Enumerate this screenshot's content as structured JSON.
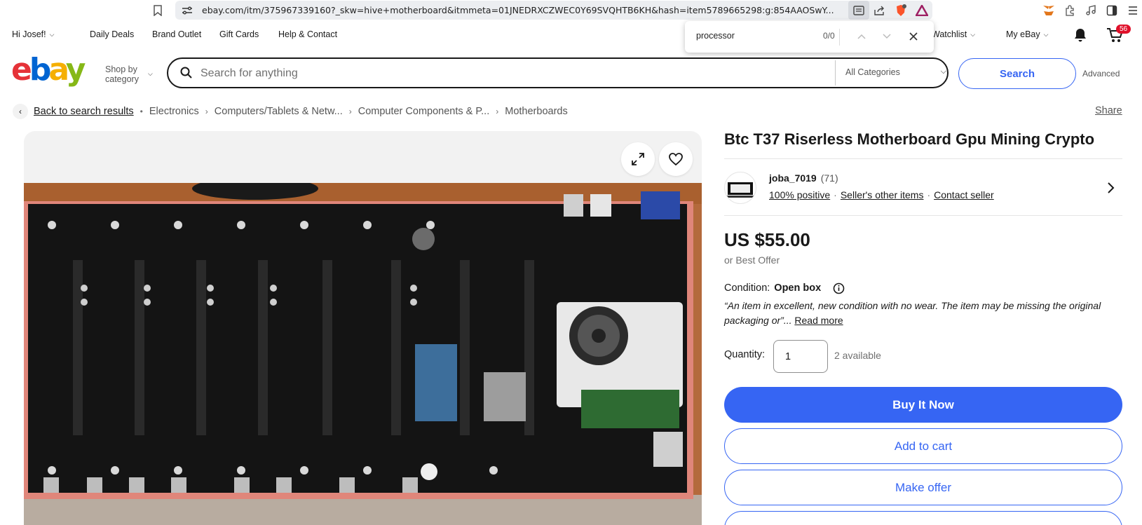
{
  "browser": {
    "url": "ebay.com/itm/375967339160?_skw=hive+motherboard&itmmeta=01JNEDRXCZWEC0Y69SVQHTB6KH&hash=item5789665298:g:854AAOSwY..."
  },
  "find_bar": {
    "query": "processor",
    "count": "0/0"
  },
  "top_nav": {
    "greeting": "Hi Josef!",
    "daily_deals": "Daily Deals",
    "brand_outlet": "Brand Outlet",
    "gift_cards": "Gift Cards",
    "help_contact": "Help & Contact",
    "watchlist": "Watchlist",
    "my_ebay": "My eBay",
    "cart_count": "56"
  },
  "header": {
    "shop_by_line1": "Shop by",
    "shop_by_line2": "category",
    "search_placeholder": "Search for anything",
    "category": "All Categories",
    "search_button": "Search",
    "advanced": "Advanced"
  },
  "breadcrumb": {
    "back": "Back to search results",
    "items": [
      "Electronics",
      "Computers/Tablets & Netw...",
      "Computer Components & P...",
      "Motherboards"
    ],
    "share": "Share"
  },
  "product": {
    "title": "Btc T37 Riserless Motherboard Gpu Mining Crypto",
    "seller_name": "joba_7019",
    "seller_score": "(71)",
    "seller_positive": "100% positive",
    "seller_other_items": "Seller's other items",
    "contact_seller": "Contact seller",
    "price": "US $55.00",
    "best_offer": "or Best Offer",
    "condition_label": "Condition:",
    "condition_value": "Open box",
    "condition_desc": "“An item in excellent, new condition with no wear. The item may be missing the original packaging or”...",
    "read_more": "Read more",
    "quantity_label": "Quantity:",
    "quantity_value": "1",
    "available": "2 available",
    "buy_now": "Buy It Now",
    "add_to_cart": "Add to cart",
    "make_offer": "Make offer"
  },
  "colors": {
    "accent": "#3665f3",
    "text": "#191919",
    "muted": "#707070",
    "badge": "#e0102a"
  }
}
